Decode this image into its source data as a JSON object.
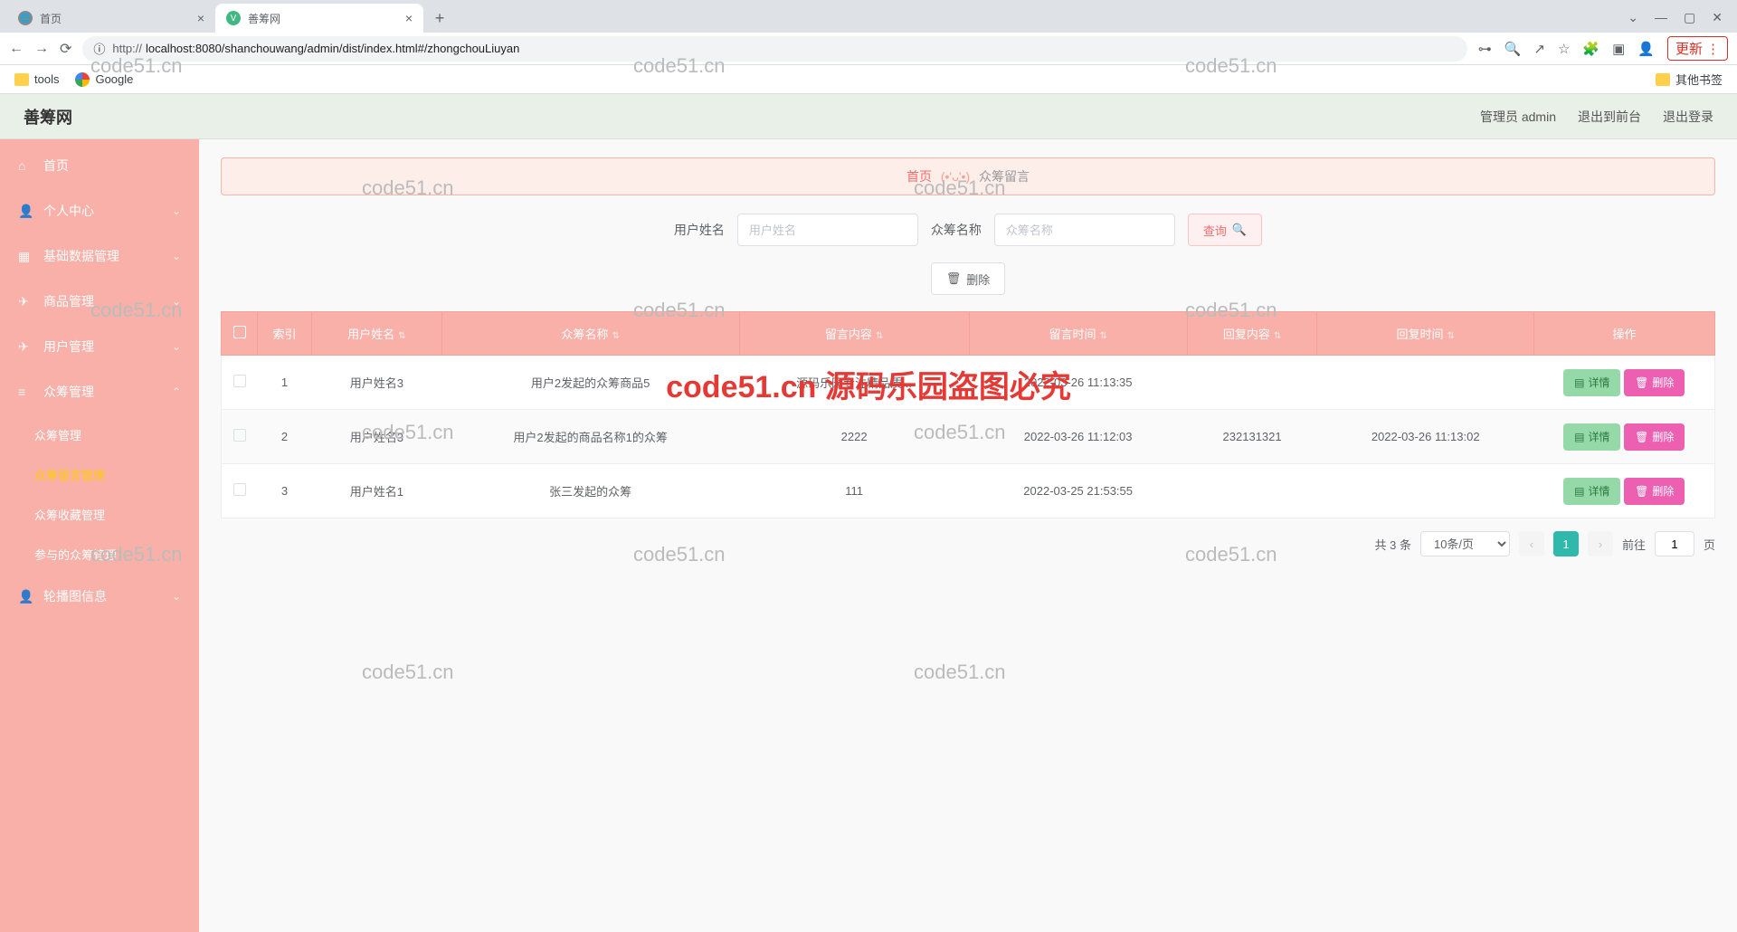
{
  "browser": {
    "tabs": [
      {
        "title": "首页"
      },
      {
        "title": "善筹网"
      }
    ],
    "url_display": "localhost:8080/shanchouwang/admin/dist/index.html#/zhongchouLiuyan",
    "url_protocol": "http://",
    "update_label": "更新",
    "bookmarks": {
      "tools": "tools",
      "google": "Google",
      "other": "其他书签"
    }
  },
  "header": {
    "title": "善筹网",
    "admin_label": "管理员 admin",
    "to_front": "退出到前台",
    "logout": "退出登录"
  },
  "sidebar": {
    "home": "首页",
    "personal": "个人中心",
    "basic": "基础数据管理",
    "product": "商品管理",
    "user": "用户管理",
    "crowd": "众筹管理",
    "crowd_sub": {
      "manage": "众筹管理",
      "comment": "众筹留言管理",
      "favorite": "众筹收藏管理",
      "join": "参与的众筹管理"
    },
    "carousel": "轮播图信息"
  },
  "breadcrumb": {
    "home": "首页",
    "sep": "(•'ᴗ'•)",
    "current": "众筹留言"
  },
  "search": {
    "user_label": "用户姓名",
    "user_placeholder": "用户姓名",
    "crowd_label": "众筹名称",
    "crowd_placeholder": "众筹名称",
    "query_btn": "查询"
  },
  "actions": {
    "delete_btn": "删除"
  },
  "table": {
    "headers": {
      "index": "索引",
      "user": "用户姓名",
      "crowd": "众筹名称",
      "content": "留言内容",
      "time": "留言时间",
      "reply": "回复内容",
      "reply_time": "回复时间",
      "ops": "操作"
    },
    "rows": [
      {
        "idx": "1",
        "user": "用户姓名3",
        "crowd": "用户2发起的众筹商品5",
        "content": "源码乐园专注精品质...",
        "time": "2022-03-26 11:13:35",
        "reply": "",
        "reply_time": ""
      },
      {
        "idx": "2",
        "user": "用户姓名3",
        "crowd": "用户2发起的商品名称1的众筹",
        "content": "2222",
        "time": "2022-03-26 11:12:03",
        "reply": "232131321",
        "reply_time": "2022-03-26 11:13:02"
      },
      {
        "idx": "3",
        "user": "用户姓名1",
        "crowd": "张三发起的众筹",
        "content": "111",
        "time": "2022-03-25 21:53:55",
        "reply": "",
        "reply_time": ""
      }
    ],
    "row_btns": {
      "detail": "详情",
      "delete": "删除"
    }
  },
  "pagination": {
    "total": "共 3 条",
    "per_page": "10条/页",
    "current": "1",
    "goto_label": "前往",
    "goto_value": "1",
    "page_suffix": "页"
  },
  "watermark": "code51.cn 源码乐园盗图必究",
  "wm_small": "code51.cn"
}
